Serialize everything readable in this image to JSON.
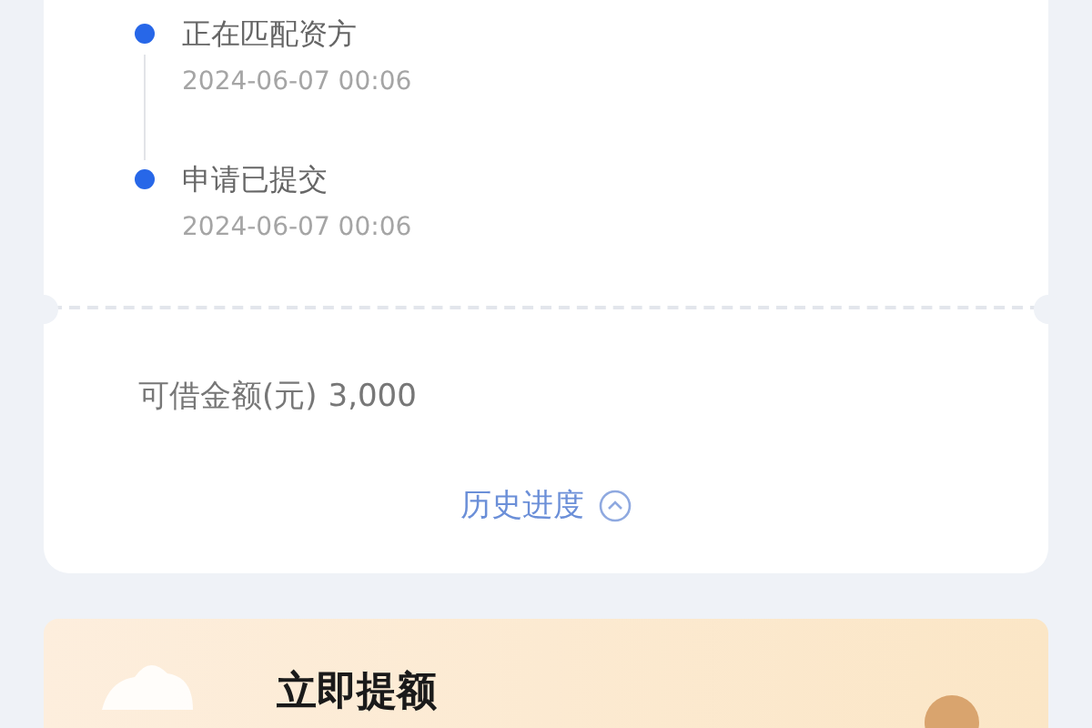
{
  "timeline": [
    {
      "title": "正在匹配资方",
      "time": "2024-06-07 00:06"
    },
    {
      "title": "申请已提交",
      "time": "2024-06-07 00:06"
    }
  ],
  "amount": {
    "label": "可借金额(元)",
    "value": "3,000"
  },
  "history_link": {
    "label": "历史进度"
  },
  "banner": {
    "title": "立即提额"
  }
}
